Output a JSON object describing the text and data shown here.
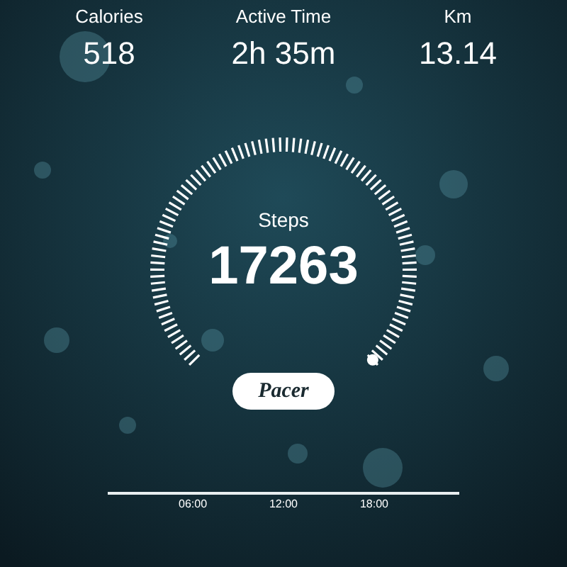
{
  "stats": [
    {
      "label": "Calories",
      "value": "518"
    },
    {
      "label": "Active Time",
      "value": "2h 35m"
    },
    {
      "label": "Km",
      "value": "13.14"
    }
  ],
  "gauge": {
    "label": "Steps",
    "value": "17263"
  },
  "logo": "Pacer",
  "timeline": {
    "ticks": [
      "06:00",
      "12:00",
      "18:00"
    ]
  }
}
